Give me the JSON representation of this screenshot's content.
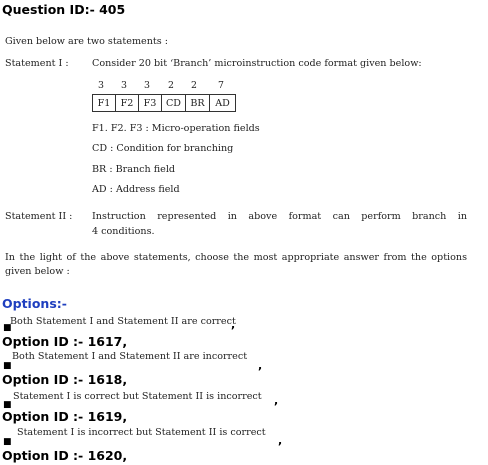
{
  "question": {
    "id_line": "Question ID:- 405"
  },
  "intro": "Given below are two statements :",
  "statement1": {
    "label": "Statement I :",
    "text": "Consider 20 bit ‘Branch’ microinstruction code format given below:",
    "bits": [
      "3",
      "3",
      "3",
      "2",
      "2",
      "7"
    ],
    "fields": [
      "F1",
      "F2",
      "F3",
      "CD",
      "BR",
      "AD"
    ],
    "legend": [
      "F1. F2. F3 : Micro-operation fields",
      "CD : Condition for branching",
      "BR : Branch field",
      "AD : Address field"
    ]
  },
  "statement2": {
    "label": "Statement II :",
    "line1": "Instruction represented in above format can perform branch in",
    "line2": "4 conditions."
  },
  "prompt": {
    "line1": "In the light of the above statements, choose the most appropriate answer from the options",
    "line2": "given below :"
  },
  "options_heading": "Options:-",
  "options": [
    {
      "bullet": "■",
      "text": "Both Statement I and Statement II are correct",
      "comma": ",",
      "id_line": "Option ID :- 1617,"
    },
    {
      "bullet": "■",
      "text": "Both Statement I and Statement II are incorrect",
      "comma": ",",
      "id_line": "Option ID :- 1618,"
    },
    {
      "bullet": "■",
      "text": "Statement I is correct but Statement II is incorrect",
      "comma": ",",
      "id_line": "Option ID :- 1619,"
    },
    {
      "bullet": "■",
      "text": "Statement I is incorrect but Statement II is correct",
      "comma": ",",
      "id_line": "Option ID :- 1620,"
    }
  ]
}
